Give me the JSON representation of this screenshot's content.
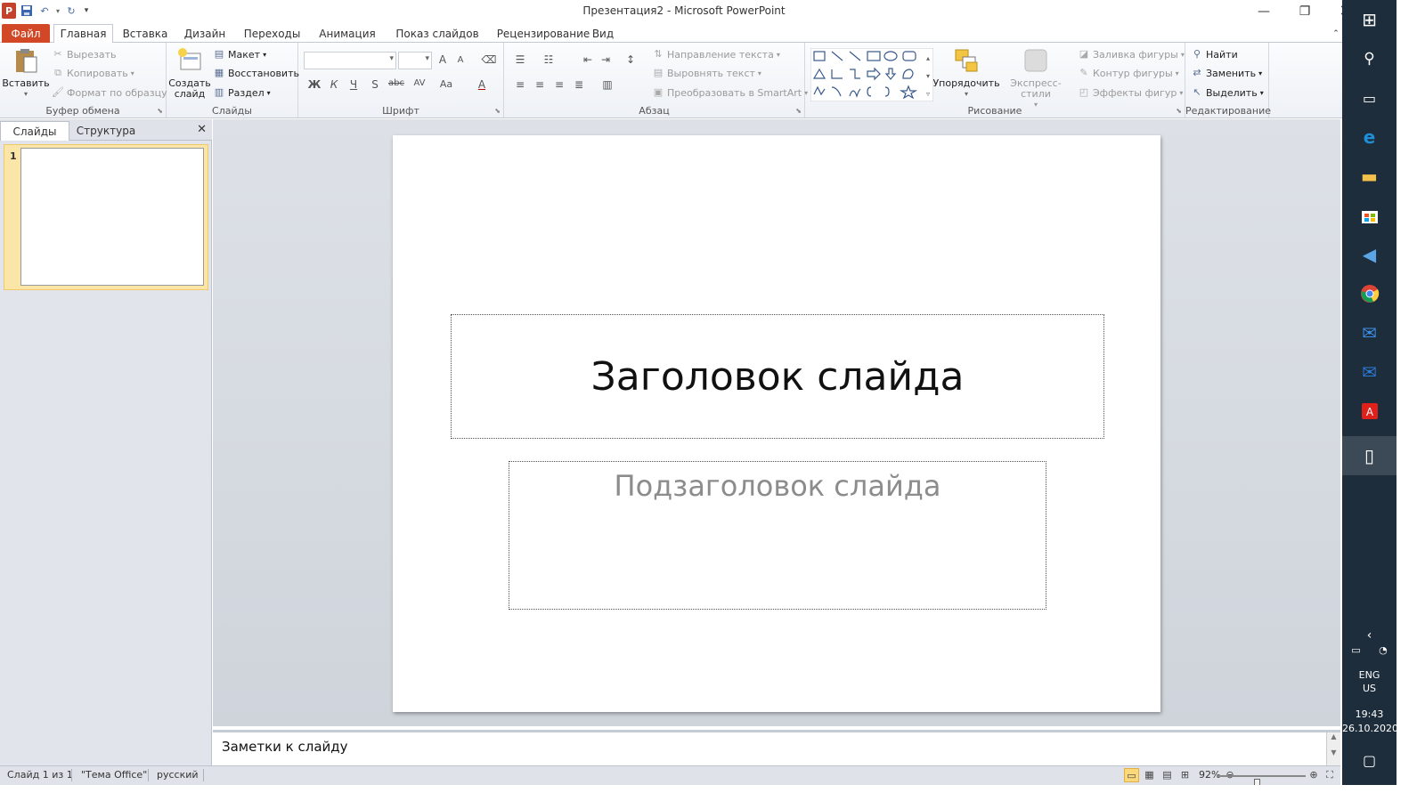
{
  "window": {
    "title": "Презентация2 - Microsoft PowerPoint",
    "app_icon": "P",
    "controls": [
      "minimize-icon",
      "restore-icon",
      "close-icon"
    ]
  },
  "qat": [
    "save-icon",
    "undo-icon",
    "redo-icon",
    "customize-icon"
  ],
  "tabs": {
    "file": "Файл",
    "home": "Главная",
    "insert": "Вставка",
    "design": "Дизайн",
    "transitions": "Переходы",
    "animation": "Анимация",
    "slideshow": "Показ слайдов",
    "review": "Рецензирование",
    "view": "Вид"
  },
  "ribbon": {
    "clipboard": {
      "label": "Буфер обмена",
      "paste": "Вставить",
      "cut": "Вырезать",
      "copy": "Копировать",
      "format_painter": "Формат по образцу"
    },
    "slides": {
      "label": "Слайды",
      "new_slide_1": "Создать",
      "new_slide_2": "слайд",
      "layout": "Макет",
      "reset": "Восстановить",
      "section": "Раздел"
    },
    "font": {
      "label": "Шрифт",
      "bold": "Ж",
      "italic": "К",
      "underline": "Ч",
      "shadow": "S",
      "strike": "abc",
      "spacing": "AV",
      "case": "Aa",
      "color": "A",
      "grow": "A",
      "shrink": "A"
    },
    "paragraph": {
      "label": "Абзац",
      "text_direction": "Направление текста",
      "align_text": "Выровнять текст",
      "smartart": "Преобразовать в SmartArt"
    },
    "drawing": {
      "label": "Рисование",
      "arrange": "Упорядочить",
      "quick_styles": "Экспресс-стили",
      "shape_fill": "Заливка фигуры",
      "shape_outline": "Контур фигуры",
      "shape_effects": "Эффекты фигур"
    },
    "editing": {
      "label": "Редактирование",
      "find": "Найти",
      "replace": "Заменить",
      "select": "Выделить"
    }
  },
  "left_pane": {
    "tab_slides": "Слайды",
    "tab_outline": "Структура",
    "thumb_number": "1"
  },
  "slide": {
    "title_placeholder": "Заголовок слайда",
    "subtitle_placeholder": "Подзаголовок слайда"
  },
  "notes": {
    "placeholder": "Заметки к слайду"
  },
  "status": {
    "slide_info": "Слайд 1 из 1",
    "theme": "\"Тема Office\"",
    "language": "русский",
    "zoom": "92%",
    "zoom_level_percent": 92
  },
  "taskbar": {
    "items": [
      "windows-icon",
      "search-icon",
      "task-view-icon",
      "edge-icon",
      "file-explorer-icon",
      "store-icon",
      "speaker-app-icon",
      "chrome-icon",
      "mail-icon",
      "mail2-icon",
      "acrobat-icon",
      "document-icon"
    ],
    "lang_1": "ENG",
    "lang_2": "US",
    "time": "19:43",
    "date": "26.10.2020"
  }
}
